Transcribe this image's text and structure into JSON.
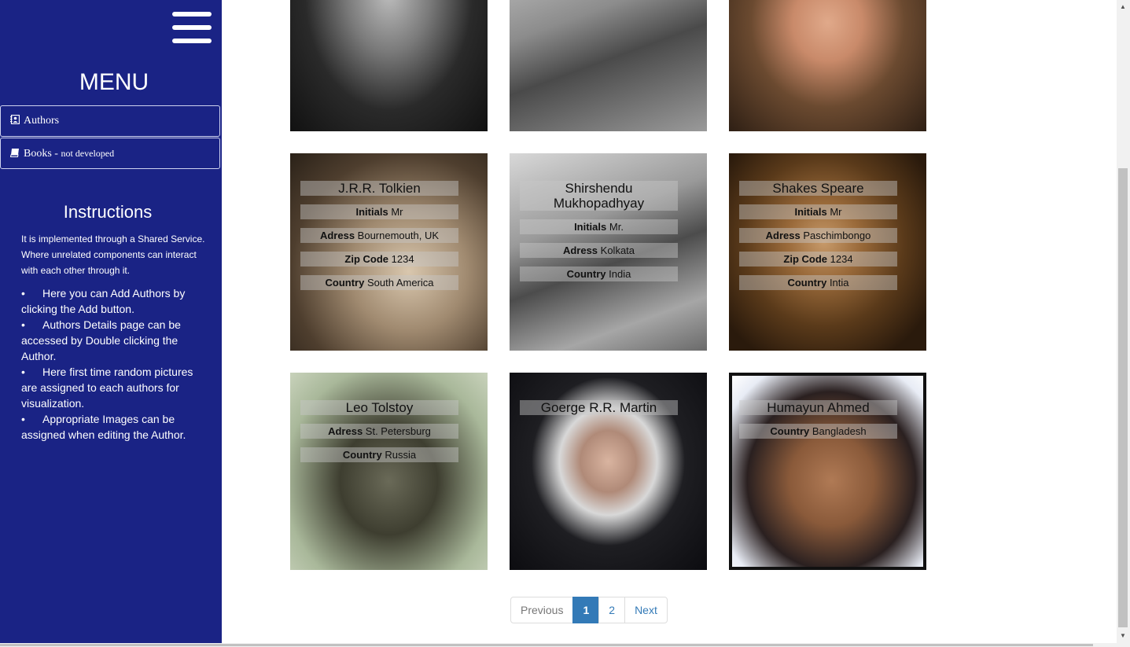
{
  "sidebar": {
    "menu_title": "MENU",
    "items": [
      {
        "label": "Authors",
        "note": ""
      },
      {
        "label": "Books - ",
        "note": "not developed"
      }
    ],
    "instructions_title": "Instructions",
    "instructions_intro": "It is implemented through a Shared Service. Where unrelated components can interact with each other through it.",
    "instructions": [
      "Here you can Add Authors by clicking the Add button.",
      "Authors Details page can be accessed by Double clicking the Author.",
      "Here first time random pictures are assigned to each authors for visualization.",
      "Appropriate Images can be assigned when editing the Author."
    ]
  },
  "authors": [
    {
      "name": "J.R.R. Tolkien",
      "initials_label": "Initials",
      "initials": "Mr",
      "adress_label": "Adress",
      "adress": "Bournemouth, UK",
      "zip_label": "Zip Code",
      "zip": "1234",
      "country_label": "Country",
      "country": "South America"
    },
    {
      "name": "Shirshendu Mukhopadhyay",
      "initials_label": "Initials",
      "initials": "Mr.",
      "adress_label": "Adress",
      "adress": "Kolkata",
      "country_label": "Country",
      "country": "India"
    },
    {
      "name": "Shakes Speare",
      "initials_label": "Initials",
      "initials": "Mr",
      "adress_label": "Adress",
      "adress": "Paschimbongo",
      "zip_label": "Zip Code",
      "zip": "1234",
      "country_label": "Country",
      "country": "Intia"
    },
    {
      "name": "Leo Tolstoy",
      "adress_label": "Adress",
      "adress": "St. Petersburg",
      "country_label": "Country",
      "country": "Russia"
    },
    {
      "name": "Goerge R.R. Martin"
    },
    {
      "name": "Humayun Ahmed",
      "country_label": "Country",
      "country": "Bangladesh"
    }
  ],
  "pagination": {
    "previous": "Previous",
    "pages": [
      "1",
      "2"
    ],
    "active_page": "1",
    "next": "Next"
  },
  "colors": {
    "sidebar": "#1a2385",
    "accent": "#337ab7"
  },
  "icons": {
    "authors": "address-book-icon",
    "books": "book-icon",
    "menu": "hamburger-icon"
  }
}
